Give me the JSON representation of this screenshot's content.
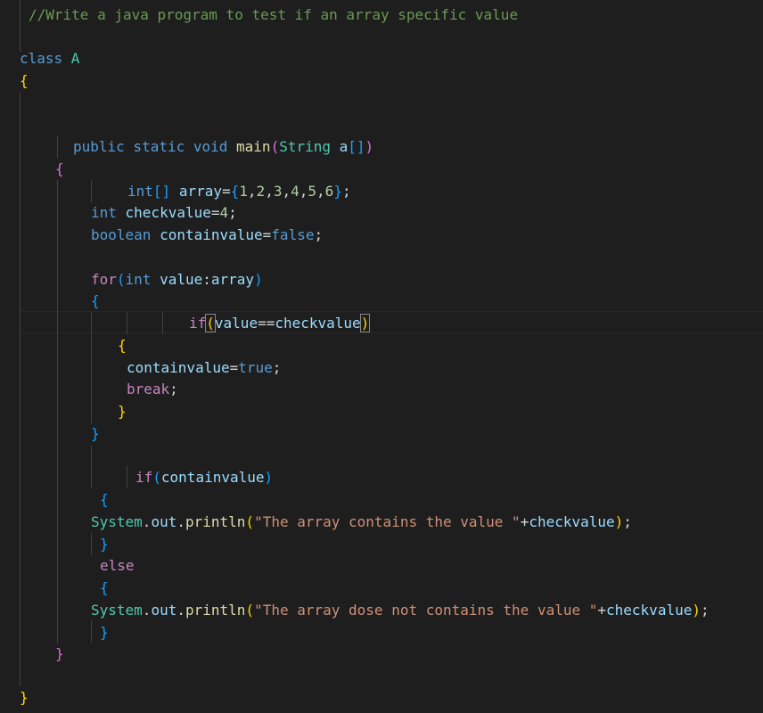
{
  "editor": {
    "lines": [
      [
        {
          "t": "//Write a java program to test if an array specific value",
          "c": "cmt"
        }
      ],
      [
        {
          "t": "class ",
          "c": "kw"
        },
        {
          "t": "A",
          "c": "type"
        }
      ],
      [
        {
          "t": "{",
          "c": "b1"
        }
      ],
      [
        {
          "t": "public static void ",
          "c": "kw"
        },
        {
          "t": "main",
          "c": "fn"
        },
        {
          "t": "(",
          "c": "b2"
        },
        {
          "t": "String ",
          "c": "type"
        },
        {
          "t": "a",
          "c": "var"
        },
        {
          "t": "[]",
          "c": "b3"
        },
        {
          "t": ")",
          "c": "b2"
        }
      ],
      [
        {
          "t": "{",
          "c": "b2"
        }
      ],
      [
        {
          "t": "int",
          "c": "kw"
        },
        {
          "t": "[] ",
          "c": "b3"
        },
        {
          "t": "array",
          "c": "var"
        },
        {
          "t": "=",
          "c": "op"
        },
        {
          "t": "{",
          "c": "b3"
        },
        {
          "t": "1",
          "c": "num"
        },
        {
          "t": ",",
          "c": "op"
        },
        {
          "t": "2",
          "c": "num"
        },
        {
          "t": ",",
          "c": "op"
        },
        {
          "t": "3",
          "c": "num"
        },
        {
          "t": ",",
          "c": "op"
        },
        {
          "t": "4",
          "c": "num"
        },
        {
          "t": ",",
          "c": "op"
        },
        {
          "t": "5",
          "c": "num"
        },
        {
          "t": ",",
          "c": "op"
        },
        {
          "t": "6",
          "c": "num"
        },
        {
          "t": "}",
          "c": "b3"
        },
        {
          "t": ";",
          "c": "op"
        }
      ],
      [
        {
          "t": "int ",
          "c": "kw"
        },
        {
          "t": "checkvalue",
          "c": "var"
        },
        {
          "t": "=",
          "c": "op"
        },
        {
          "t": "4",
          "c": "num"
        },
        {
          "t": ";",
          "c": "op"
        }
      ],
      [
        {
          "t": "boolean ",
          "c": "kw"
        },
        {
          "t": "containvalue",
          "c": "var"
        },
        {
          "t": "=",
          "c": "op"
        },
        {
          "t": "false",
          "c": "kw"
        },
        {
          "t": ";",
          "c": "op"
        }
      ],
      [
        {
          "t": "for",
          "c": "ctrl"
        },
        {
          "t": "(",
          "c": "b3"
        },
        {
          "t": "int ",
          "c": "kw"
        },
        {
          "t": "value",
          "c": "var"
        },
        {
          "t": ":",
          "c": "op"
        },
        {
          "t": "array",
          "c": "var"
        },
        {
          "t": ")",
          "c": "b3"
        }
      ],
      [
        {
          "t": "{",
          "c": "b3"
        }
      ],
      [
        {
          "t": "if",
          "c": "ctrl"
        },
        {
          "t": "(",
          "c": "b1"
        },
        {
          "t": "value",
          "c": "var"
        },
        {
          "t": "==",
          "c": "op"
        },
        {
          "t": "checkvalue",
          "c": "var"
        },
        {
          "t": ")",
          "c": "b1"
        }
      ],
      [
        {
          "t": "{",
          "c": "b1"
        }
      ],
      [
        {
          "t": "containvalue",
          "c": "var"
        },
        {
          "t": "=",
          "c": "op"
        },
        {
          "t": "true",
          "c": "kw"
        },
        {
          "t": ";",
          "c": "op"
        }
      ],
      [
        {
          "t": "break",
          "c": "ctrl"
        },
        {
          "t": ";",
          "c": "op"
        }
      ],
      [
        {
          "t": "}",
          "c": "b1"
        }
      ],
      [
        {
          "t": "}",
          "c": "b3"
        }
      ],
      [
        {
          "t": "if",
          "c": "ctrl"
        },
        {
          "t": "(",
          "c": "b3"
        },
        {
          "t": "containvalue",
          "c": "var"
        },
        {
          "t": ")",
          "c": "b3"
        }
      ],
      [
        {
          "t": "{",
          "c": "b3"
        }
      ],
      [
        {
          "t": "System",
          "c": "type"
        },
        {
          "t": ".",
          "c": "op"
        },
        {
          "t": "out",
          "c": "var"
        },
        {
          "t": ".",
          "c": "op"
        },
        {
          "t": "println",
          "c": "fn"
        },
        {
          "t": "(",
          "c": "b1"
        },
        {
          "t": "\"The array contains the value \"",
          "c": "str"
        },
        {
          "t": "+",
          "c": "op"
        },
        {
          "t": "checkvalue",
          "c": "var"
        },
        {
          "t": ")",
          "c": "b1"
        },
        {
          "t": ";",
          "c": "op"
        }
      ],
      [
        {
          "t": "}",
          "c": "b3"
        }
      ],
      [
        {
          "t": "else",
          "c": "ctrl"
        }
      ],
      [
        {
          "t": "{",
          "c": "b3"
        }
      ],
      [
        {
          "t": "System",
          "c": "type"
        },
        {
          "t": ".",
          "c": "op"
        },
        {
          "t": "out",
          "c": "var"
        },
        {
          "t": ".",
          "c": "op"
        },
        {
          "t": "println",
          "c": "fn"
        },
        {
          "t": "(",
          "c": "b1"
        },
        {
          "t": "\"The array dose not contains the value \"",
          "c": "str"
        },
        {
          "t": "+",
          "c": "op"
        },
        {
          "t": "checkvalue",
          "c": "var"
        },
        {
          "t": ")",
          "c": "b1"
        },
        {
          "t": ";",
          "c": "op"
        }
      ],
      [
        {
          "t": "}",
          "c": "b3"
        }
      ],
      [
        {
          "t": "}",
          "c": "b2"
        }
      ],
      [
        {
          "t": "}",
          "c": "b1"
        }
      ]
    ]
  },
  "theme": {
    "background": "#1e1e1e",
    "comment": "#6a9955",
    "keyword": "#569cd6",
    "control": "#c586c0",
    "type": "#4ec9b0",
    "function": "#dcdcaa",
    "variable": "#9cdcfe",
    "number": "#b5cea8",
    "string": "#ce9178",
    "bracket_1": "#ffd700",
    "bracket_2": "#da70d6",
    "bracket_3": "#179fff"
  }
}
